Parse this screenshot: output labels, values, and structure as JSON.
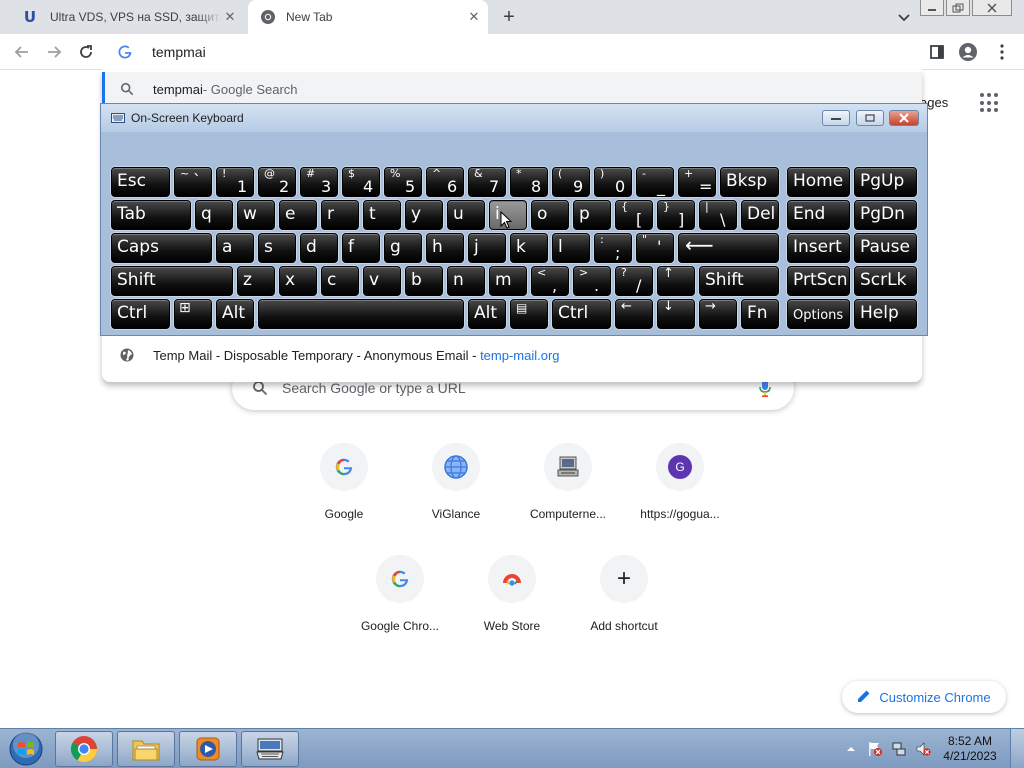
{
  "tabs": [
    {
      "title": "Ultra VDS, VPS на SSD, защита от DDoS",
      "favicon": "U",
      "active": false
    },
    {
      "title": "New Tab",
      "active": true
    }
  ],
  "new_tab_glyph": "+",
  "tab_close_glyph": "✕",
  "omnibox": {
    "value": "tempmai"
  },
  "suggestions": [
    {
      "bold": "tempmai",
      "rest": " - Google Search",
      "icon": "search-icon"
    },
    {
      "title": "Temp Mail - Disposable Temporary - Anonymous Email - ",
      "url": "temp-mail.org",
      "icon": "globe-icon"
    }
  ],
  "ntp": {
    "images_label": "ages",
    "search_placeholder": "Search Google or type a URL",
    "shortcuts": [
      {
        "label": "Google",
        "icon": "google-icon"
      },
      {
        "label": "ViGlance",
        "icon": "globe-icon"
      },
      {
        "label": "Computerne...",
        "icon": "computer-icon"
      },
      {
        "label": "https://gogua...",
        "icon": "letter-g-icon",
        "letter": "G"
      },
      {
        "label": "Google Chro...",
        "icon": "google-icon"
      },
      {
        "label": "Web Store",
        "icon": "web-store-icon"
      },
      {
        "label": "Add shortcut",
        "icon": "plus-icon",
        "glyph": "+"
      }
    ],
    "customize_label": "Customize Chrome"
  },
  "osk": {
    "title": "On-Screen Keyboard",
    "keys": {
      "esc": "Esc",
      "bksp": "Bksp",
      "home": "Home",
      "pgup": "PgUp",
      "tab": "Tab",
      "del": "Del",
      "end": "End",
      "pgdn": "PgDn",
      "caps": "Caps",
      "insert": "Insert",
      "pause": "Pause",
      "shift_l": "Shift",
      "shift_r": "Shift",
      "prtscn": "PrtScn",
      "scrlk": "ScrLk",
      "ctrl_l": "Ctrl",
      "alt_l": "Alt",
      "alt_r": "Alt",
      "ctrl_r": "Ctrl",
      "fn": "Fn",
      "options": "Options",
      "help": "Help",
      "tilde_s": "~",
      "tilde_p": "`",
      "d1_s": "!",
      "d1_p": "1",
      "d2_s": "@",
      "d2_p": "2",
      "d3_s": "#",
      "d3_p": "3",
      "d4_s": "$",
      "d4_p": "4",
      "d5_s": "%",
      "d5_p": "5",
      "d6_s": "^",
      "d6_p": "6",
      "d7_s": "&",
      "d7_p": "7",
      "d8_s": "*",
      "d8_p": "8",
      "d9_s": "(",
      "d9_p": "9",
      "d0_s": ")",
      "d0_p": "0",
      "minus_s": "-",
      "minus_p": "_",
      "plus_s": "+",
      "plus_p": "=",
      "q": "q",
      "w": "w",
      "e": "e",
      "r": "r",
      "t": "t",
      "y": "y",
      "u": "u",
      "i": "i",
      "o": "o",
      "p": "p",
      "lbr_s": "{",
      "lbr_p": "[",
      "rbr_s": "}",
      "rbr_p": "]",
      "bsl_s": "|",
      "bsl_p": "\\",
      "a": "a",
      "s": "s",
      "d": "d",
      "f": "f",
      "g": "g",
      "h": "h",
      "j": "j",
      "k": "k",
      "l": "l",
      "semi_s": ":",
      "semi_p": ";",
      "quote_s": "\"",
      "quote_p": "'",
      "enter": "⟵",
      "z": "z",
      "x": "x",
      "c": "c",
      "v": "v",
      "b": "b",
      "n": "n",
      "m": "m",
      "comma_s": "<",
      "comma_p": ",",
      "period_s": ">",
      "period_p": ".",
      "slash_s": "?",
      "slash_p": "/",
      "up": "↑",
      "left": "←",
      "down": "↓",
      "right": "→",
      "menu": "▤",
      "win": "⊞"
    }
  },
  "taskbar": {
    "time": "8:52 AM",
    "date": "4/21/2023"
  },
  "colors": {
    "accent": "#1a73e8",
    "osk_bg": "#a7bfdb",
    "key_bg": "#111111",
    "taskbar": "#8ca7cb"
  }
}
